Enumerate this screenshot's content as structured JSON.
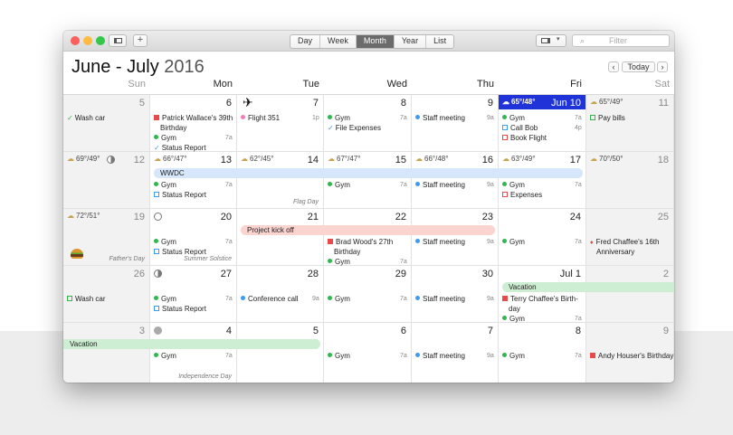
{
  "toolbar": {
    "views": [
      "Day",
      "Week",
      "Month",
      "Year",
      "List"
    ],
    "active": "Month",
    "search_placeholder": "Filter",
    "add": "+",
    "sidebar_toggle": "sidebar-icon",
    "traffic": [
      "#fc605c",
      "#fdbc40",
      "#34c84a"
    ]
  },
  "header": {
    "title": "June - July",
    "year": "2016",
    "today": "Today",
    "prev": "‹",
    "next": "›"
  },
  "weekdays": [
    "Sun",
    "Mon",
    "Tue",
    "Wed",
    "Thu",
    "Fri",
    "Sat"
  ],
  "colors": {
    "gym": "#2eb84d",
    "blue": "#3b9cf2",
    "red": "#e84a4a",
    "pink": "#f07fb8",
    "green": "#34b54a",
    "today": "#1f33d9"
  },
  "weeks": [
    {
      "days": [
        {
          "d": "5",
          "events": [
            {
              "k": "chk",
              "c": "green",
              "text": "Wash car"
            }
          ]
        },
        {
          "d": "6",
          "events": [
            {
              "k": "bday",
              "c": "red",
              "text": "Patrick Wallace's 39th"
            },
            {
              "k": "cont",
              "text": "Birthday"
            },
            {
              "k": "dot",
              "c": "gym",
              "text": "Gym",
              "time": "7a"
            },
            {
              "k": "chk",
              "c": "blue",
              "text": "Status Report"
            }
          ]
        },
        {
          "d": "7",
          "icon": "airplane-icon",
          "events": [
            {
              "k": "dot",
              "c": "pink",
              "text": "Flight 351",
              "time": "1p"
            }
          ]
        },
        {
          "d": "8",
          "events": [
            {
              "k": "dot",
              "c": "gym",
              "text": "Gym",
              "time": "7a"
            },
            {
              "k": "chk",
              "c": "blue",
              "text": "File Expenses"
            }
          ]
        },
        {
          "d": "9",
          "events": [
            {
              "k": "dot",
              "c": "blue",
              "text": "Staff meeting",
              "time": "9a"
            }
          ]
        },
        {
          "d": "Jun 10",
          "today": true,
          "weather": "65°/48°",
          "events": [
            {
              "k": "dot",
              "c": "gym",
              "text": "Gym",
              "time": "7a"
            },
            {
              "k": "sq",
              "c": "blue",
              "text": "Call Bob",
              "time": "4p"
            },
            {
              "k": "sq",
              "c": "red",
              "text": "Book Flight"
            }
          ]
        },
        {
          "d": "11",
          "weather": "65°/49°",
          "events": [
            {
              "k": "sq",
              "c": "green",
              "text": "Pay bills"
            }
          ]
        }
      ]
    },
    {
      "days": [
        {
          "d": "12",
          "weather": "69°/49°",
          "moon": "half"
        },
        {
          "d": "13",
          "weather": "66°/47°",
          "events": [
            {
              "k": "dot",
              "c": "gym",
              "text": "Gym",
              "time": "7a"
            },
            {
              "k": "sq",
              "c": "blue",
              "text": "Status Report"
            }
          ]
        },
        {
          "d": "14",
          "weather": "62°/45°",
          "holiday": "Flag Day"
        },
        {
          "d": "15",
          "weather": "67°/47°",
          "events": [
            {
              "k": "dot",
              "c": "gym",
              "text": "Gym",
              "time": "7a"
            }
          ]
        },
        {
          "d": "16",
          "weather": "66°/48°",
          "events": [
            {
              "k": "dot",
              "c": "blue",
              "text": "Staff meeting",
              "time": "9a"
            }
          ]
        },
        {
          "d": "17",
          "weather": "63°/49°",
          "events": [
            {
              "k": "dot",
              "c": "gym",
              "text": "Gym",
              "time": "7a"
            },
            {
              "k": "sq",
              "c": "red",
              "text": "Expenses"
            }
          ]
        },
        {
          "d": "18",
          "weather": "70°/50°"
        }
      ],
      "bar": {
        "text": "WWDC",
        "bg": "#d6e6fb"
      }
    },
    {
      "days": [
        {
          "d": "19",
          "weather": "72°/51°",
          "holiday": "Father's Day",
          "icon": "burger-icon"
        },
        {
          "d": "20",
          "moon": "empty",
          "holiday": "Summer Solstice",
          "events": [
            {
              "k": "dot",
              "c": "gym",
              "text": "Gym",
              "time": "7a"
            },
            {
              "k": "sq",
              "c": "blue",
              "text": "Status Report"
            }
          ]
        },
        {
          "d": "21"
        },
        {
          "d": "22",
          "events": [
            {
              "k": "bday",
              "c": "red",
              "text": "Brad Wood's 27th"
            },
            {
              "k": "cont",
              "text": "Birthday"
            },
            {
              "k": "dot",
              "c": "gym",
              "text": "Gym",
              "time": "7a"
            }
          ]
        },
        {
          "d": "23",
          "events": [
            {
              "k": "dot",
              "c": "blue",
              "text": "Staff meeting",
              "time": "9a"
            }
          ]
        },
        {
          "d": "24",
          "events": [
            {
              "k": "dot",
              "c": "gym",
              "text": "Gym",
              "time": "7a"
            }
          ]
        },
        {
          "d": "25",
          "events": [
            {
              "k": "drop",
              "c": "red",
              "text": "Fred Chaffee's 16th"
            },
            {
              "k": "cont",
              "text": "Anniversary"
            }
          ]
        }
      ],
      "bar": {
        "text": "Project kick off",
        "bg": "#fbd3cf"
      }
    },
    {
      "days": [
        {
          "d": "26",
          "events": [
            {
              "k": "sq",
              "c": "green",
              "text": "Wash car"
            }
          ]
        },
        {
          "d": "27",
          "moon": "half",
          "events": [
            {
              "k": "dot",
              "c": "gym",
              "text": "Gym",
              "time": "7a"
            },
            {
              "k": "sq",
              "c": "blue",
              "text": "Status Report"
            }
          ]
        },
        {
          "d": "28",
          "events": [
            {
              "k": "dot",
              "c": "blue",
              "text": "Conference call",
              "time": "9a"
            }
          ]
        },
        {
          "d": "29",
          "events": [
            {
              "k": "dot",
              "c": "gym",
              "text": "Gym",
              "time": "7a"
            }
          ]
        },
        {
          "d": "30",
          "events": [
            {
              "k": "dot",
              "c": "blue",
              "text": "Staff meeting",
              "time": "9a"
            }
          ]
        },
        {
          "d": "Jul 1",
          "events": [
            {
              "k": "bday",
              "c": "red",
              "text": "Terry Chaffee's Birth-"
            },
            {
              "k": "cont",
              "text": "day"
            },
            {
              "k": "dot",
              "c": "gym",
              "text": "Gym",
              "time": "7a"
            }
          ]
        },
        {
          "d": "2"
        }
      ],
      "bar": {
        "text": "Vacation",
        "bg": "#cdeed2"
      }
    },
    {
      "days": [
        {
          "d": "3"
        },
        {
          "d": "4",
          "moon": "full",
          "holiday": "Independence Day",
          "events": [
            {
              "k": "dot",
              "c": "gym",
              "text": "Gym",
              "time": "7a"
            }
          ]
        },
        {
          "d": "5"
        },
        {
          "d": "6",
          "events": [
            {
              "k": "dot",
              "c": "gym",
              "text": "Gym",
              "time": "7a"
            }
          ]
        },
        {
          "d": "7",
          "events": [
            {
              "k": "dot",
              "c": "blue",
              "text": "Staff meeting",
              "time": "9a"
            }
          ]
        },
        {
          "d": "8",
          "events": [
            {
              "k": "dot",
              "c": "gym",
              "text": "Gym",
              "time": "7a"
            }
          ]
        },
        {
          "d": "9",
          "events": [
            {
              "k": "bday",
              "c": "red",
              "text": "Andy Houser's Birthday"
            }
          ]
        }
      ],
      "bar": {
        "text": "Vacation",
        "bg": "#cdeed2"
      }
    }
  ]
}
